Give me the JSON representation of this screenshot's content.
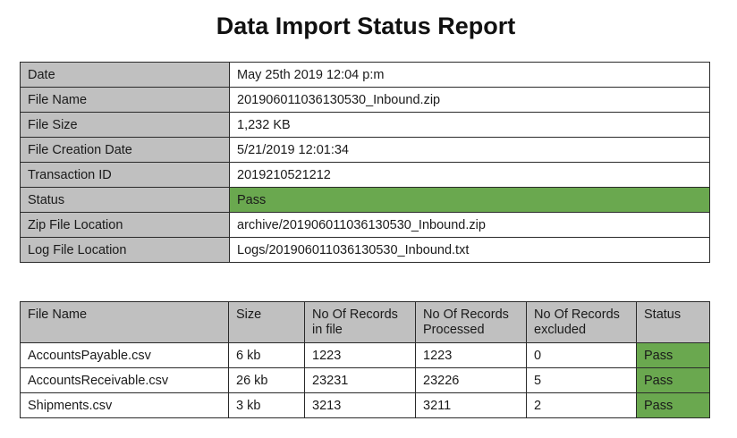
{
  "title": "Data Import Status Report",
  "summary": {
    "rows": [
      {
        "label": "Date",
        "value": "May 25th 2019 12:04 p:m"
      },
      {
        "label": "File Name",
        "value": "201906011036130530_Inbound.zip"
      },
      {
        "label": "File Size",
        "value": "1,232 KB"
      },
      {
        "label": "File Creation Date",
        "value": "5/21/2019 12:01:34"
      },
      {
        "label": "Transaction ID",
        "value": "2019210521212"
      },
      {
        "label": "Status",
        "value": "Pass"
      },
      {
        "label": "Zip File Location",
        "value": "archive/201906011036130530_Inbound.zip"
      },
      {
        "label": "Log File Location",
        "value": "Logs/201906011036130530_Inbound.txt"
      }
    ]
  },
  "files": {
    "headers": {
      "file_name": "File Name",
      "size": "Size",
      "records_in_file_1": "No Of Records",
      "records_in_file_2": "in file",
      "records_processed_1": "No Of Records",
      "records_processed_2": "Processed",
      "records_excluded_1": "No Of Records",
      "records_excluded_2": "excluded",
      "status": "Status"
    },
    "rows": [
      {
        "file_name": "AccountsPayable.csv",
        "size": "6 kb",
        "records_in_file": "1223",
        "records_processed": "1223",
        "records_excluded": "0",
        "status": "Pass"
      },
      {
        "file_name": "AccountsReceivable.csv",
        "size": "26 kb",
        "records_in_file": "23231",
        "records_processed": "23226",
        "records_excluded": "5",
        "status": "Pass"
      },
      {
        "file_name": "Shipments.csv",
        "size": "3 kb",
        "records_in_file": "3213",
        "records_processed": "3211",
        "records_excluded": "2",
        "status": "Pass"
      }
    ]
  },
  "colors": {
    "header_gray": "#c0c0c0",
    "pass_green": "#6aa84f",
    "border": "#2a2a2a"
  }
}
